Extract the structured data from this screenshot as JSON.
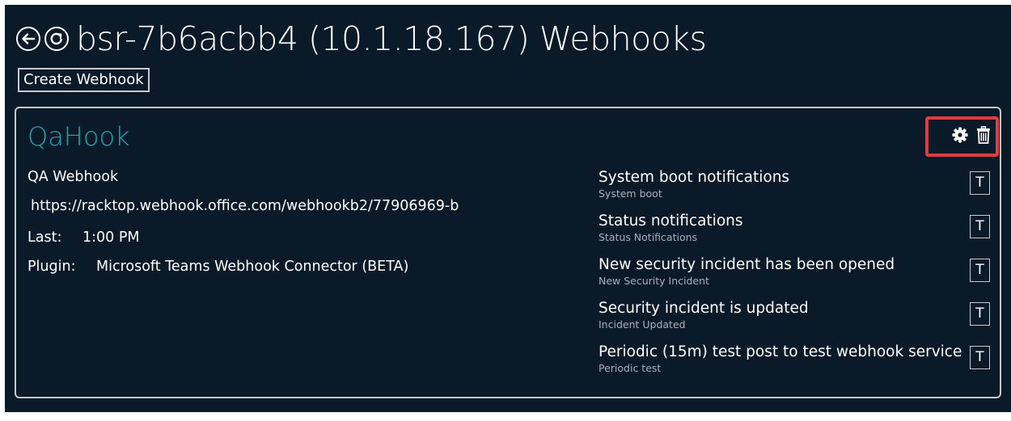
{
  "header": {
    "title": "bsr-7b6acbb4 (10.1.18.167) Webhooks",
    "back_icon": "back-arrow-circle-icon",
    "refresh_icon": "refresh-circle-icon"
  },
  "toolbar": {
    "create_label": "Create Webhook"
  },
  "webhook": {
    "name": "QaHook",
    "description": "QA Webhook",
    "url": "https://racktop.webhook.office.com/webhookb2/77906969-b",
    "last_label": "Last:",
    "last_value": "1:00 PM",
    "plugin_label": "Plugin:",
    "plugin_value": "Microsoft Teams Webhook Connector (BETA)",
    "actions": {
      "settings_icon": "gear-icon",
      "delete_icon": "trash-icon",
      "highlight_color": "#e8383b"
    },
    "notifications": [
      {
        "title": "System boot notifications",
        "subtitle": "System boot",
        "test_label": "T"
      },
      {
        "title": "Status notifications",
        "subtitle": "Status Notifications",
        "test_label": "T"
      },
      {
        "title": "New security incident has been opened",
        "subtitle": "New Security Incident",
        "test_label": "T"
      },
      {
        "title": "Security incident is updated",
        "subtitle": "Incident Updated",
        "test_label": "T"
      },
      {
        "title": "Periodic (15m) test post to test webhook service",
        "subtitle": "Periodic test",
        "test_label": "T"
      }
    ]
  },
  "colors": {
    "background": "#0b1a29",
    "accent": "#18a6b5",
    "text": "#ffffff",
    "subtext": "#a7b0ba"
  }
}
